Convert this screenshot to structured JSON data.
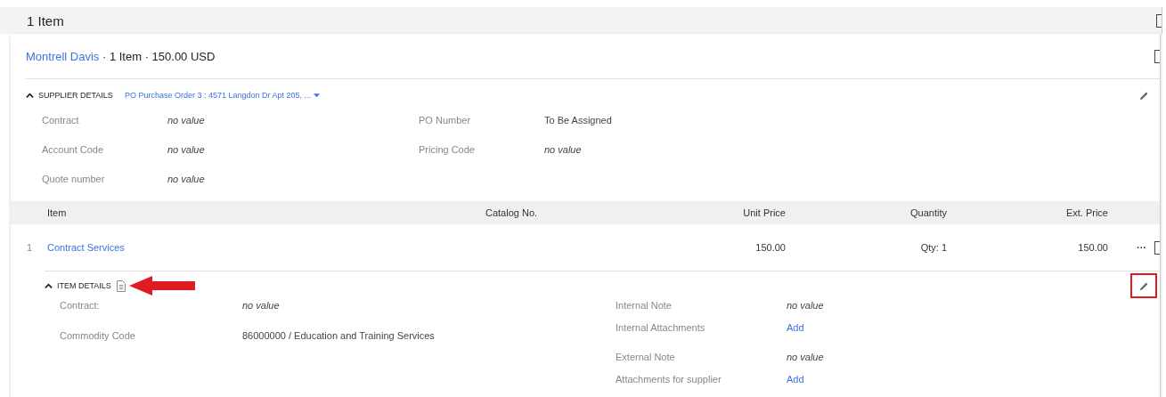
{
  "section_title": "1 Item",
  "section_checked": false,
  "supplier_card": {
    "supplier_name": "Montrell Davis",
    "summary": " · 1 Item · 150.00 USD",
    "checked": false,
    "supplier_details": {
      "title": "SUPPLIER DETAILS",
      "expanded": true,
      "purchase_order": "PO Purchase Order 3 : 4571 Langdon Dr Apt 205, ...",
      "fields": [
        {
          "label": "Contract",
          "value": "no value",
          "kind": "empty"
        },
        {
          "label": "PO Number",
          "value": "To Be Assigned",
          "kind": "text"
        },
        {
          "label": "Account Code",
          "value": "no value",
          "kind": "empty"
        },
        {
          "label": "Pricing Code",
          "value": "no value",
          "kind": "empty"
        },
        {
          "label": "Quote number",
          "value": "no value",
          "kind": "empty"
        }
      ]
    },
    "table": {
      "columns": [
        "Item",
        "Catalog No.",
        "Unit Price",
        "Quantity",
        "Ext. Price"
      ],
      "rows": [
        {
          "number": "1",
          "item": "Contract Services",
          "unit_price": "150.00",
          "quantity": "Qty: 1",
          "ext_price": "150.00",
          "more": "···",
          "checked": false
        }
      ]
    },
    "item_details": {
      "title": "ITEM DETAILS",
      "expanded": true,
      "left_fields": [
        {
          "label": "Contract:",
          "value": "no value",
          "kind": "empty"
        },
        {
          "label": "Commodity Code",
          "value": "86000000 / Education and Training Services",
          "kind": "text"
        }
      ],
      "right_groups": [
        [
          {
            "label": "Internal Note",
            "value": "no value",
            "kind": "empty"
          },
          {
            "label": "Internal Attachments",
            "value": "Add",
            "kind": "link"
          }
        ],
        [
          {
            "label": "External Note",
            "value": "no value",
            "kind": "empty"
          },
          {
            "label": "Attachments for supplier",
            "value": "Add",
            "kind": "link"
          }
        ]
      ]
    }
  },
  "annotations": {
    "arrow": true,
    "highlight_box": true
  }
}
